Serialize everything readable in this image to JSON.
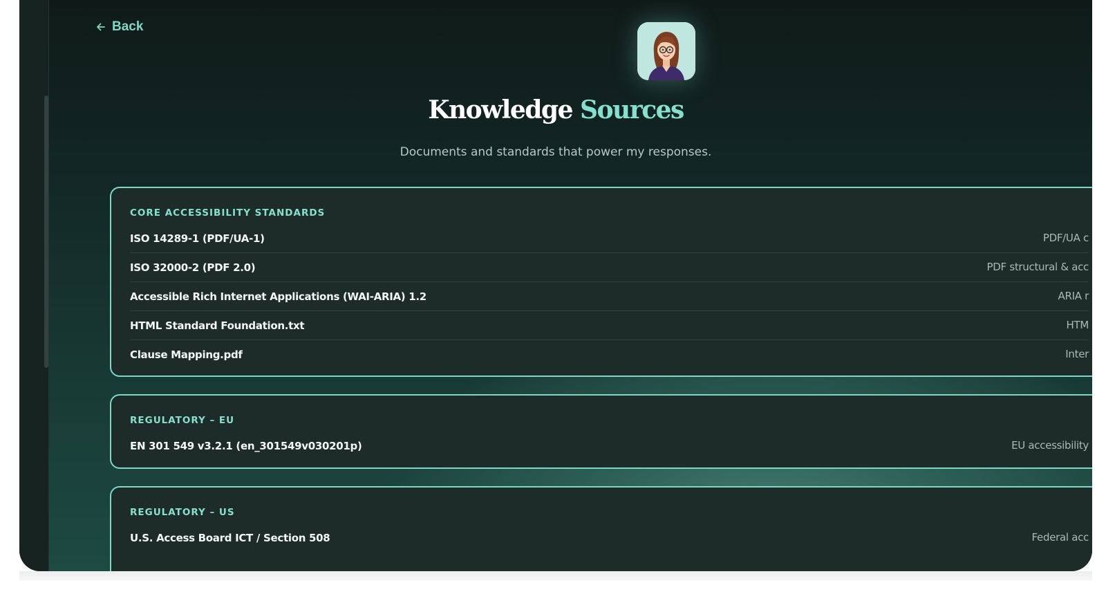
{
  "nav": {
    "back_label": "Back"
  },
  "header": {
    "title_main": "Knowledge",
    "title_accent": "Sources",
    "subtitle": "Documents and standards that power my responses."
  },
  "sections": [
    {
      "heading": "CORE ACCESSIBILITY STANDARDS",
      "items": [
        {
          "title": "ISO 14289-1 (PDF/UA-1)",
          "desc": "PDF/UA c"
        },
        {
          "title": "ISO 32000-2 (PDF 2.0)",
          "desc": "PDF structural & acc"
        },
        {
          "title": "Accessible Rich Internet Applications (WAI-ARIA) 1.2",
          "desc": "ARIA r"
        },
        {
          "title": "HTML Standard Foundation.txt",
          "desc": "HTM"
        },
        {
          "title": "Clause Mapping.pdf",
          "desc": "Inter"
        }
      ]
    },
    {
      "heading": "REGULATORY – EU",
      "items": [
        {
          "title": "EN 301 549 v3.2.1 (en_301549v030201p)",
          "desc": "EU accessibility"
        }
      ]
    },
    {
      "heading": "REGULATORY – US",
      "items": [
        {
          "title": "U.S. Access Board ICT / Section 508",
          "desc": "Federal acc"
        }
      ]
    }
  ],
  "colors": {
    "accent": "#7ed8c6",
    "background": "#0f1a18",
    "card": "#1d2b29"
  },
  "icons": [
    "arrow-left-icon",
    "assistant-avatar"
  ]
}
